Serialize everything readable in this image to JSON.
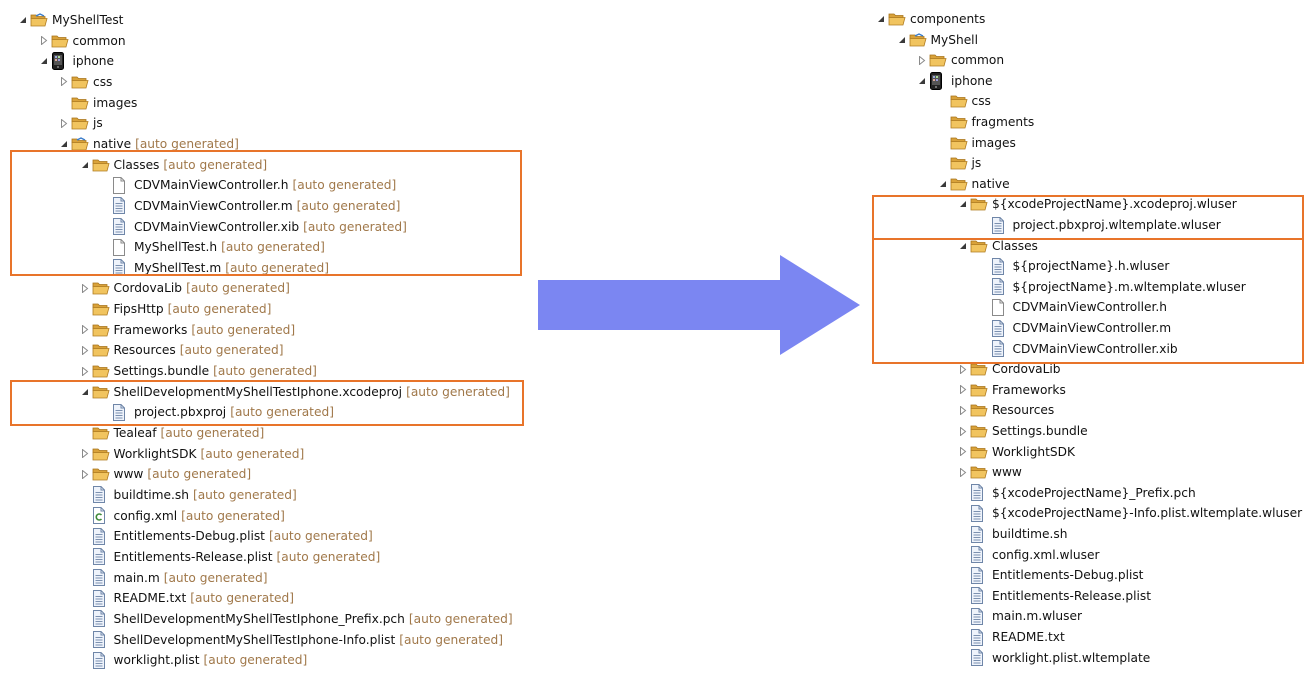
{
  "suffix": "[auto generated]",
  "colors": {
    "suffix": "#a0784a",
    "highlight": "#e8742a",
    "arrow": "#7b86f2",
    "folder": "#e8b34b"
  },
  "left_tree": [
    {
      "label": "MyShellTest",
      "icon": "project-folder-icon",
      "tw": "expanded",
      "depth": 0,
      "auto": false
    },
    {
      "label": "common",
      "icon": "folder-icon",
      "tw": "collapsed",
      "depth": 1,
      "auto": false
    },
    {
      "label": "iphone",
      "icon": "iphone-icon",
      "tw": "expanded",
      "depth": 1,
      "auto": false
    },
    {
      "label": "css",
      "icon": "folder-icon",
      "tw": "collapsed",
      "depth": 2,
      "auto": false
    },
    {
      "label": "images",
      "icon": "folder-icon",
      "tw": "none",
      "depth": 2,
      "auto": false
    },
    {
      "label": "js",
      "icon": "folder-icon",
      "tw": "collapsed",
      "depth": 2,
      "auto": false
    },
    {
      "label": "native",
      "icon": "project-folder-icon",
      "tw": "expanded",
      "depth": 2,
      "auto": true
    },
    {
      "label": "Classes",
      "icon": "folder-icon",
      "tw": "expanded",
      "depth": 3,
      "auto": true
    },
    {
      "label": "CDVMainViewController.h",
      "icon": "blank-file-icon",
      "tw": "none",
      "depth": 4,
      "auto": true
    },
    {
      "label": "CDVMainViewController.m",
      "icon": "text-file-icon",
      "tw": "none",
      "depth": 4,
      "auto": true
    },
    {
      "label": "CDVMainViewController.xib",
      "icon": "text-file-icon",
      "tw": "none",
      "depth": 4,
      "auto": true
    },
    {
      "label": "MyShellTest.h",
      "icon": "blank-file-icon",
      "tw": "none",
      "depth": 4,
      "auto": true
    },
    {
      "label": "MyShellTest.m",
      "icon": "text-file-icon",
      "tw": "none",
      "depth": 4,
      "auto": true
    },
    {
      "label": "CordovaLib",
      "icon": "folder-icon",
      "tw": "collapsed",
      "depth": 3,
      "auto": true
    },
    {
      "label": "FipsHttp",
      "icon": "folder-icon",
      "tw": "none",
      "depth": 3,
      "auto": true
    },
    {
      "label": "Frameworks",
      "icon": "folder-icon",
      "tw": "collapsed",
      "depth": 3,
      "auto": true
    },
    {
      "label": "Resources",
      "icon": "folder-icon",
      "tw": "collapsed",
      "depth": 3,
      "auto": true
    },
    {
      "label": "Settings.bundle",
      "icon": "folder-icon",
      "tw": "collapsed",
      "depth": 3,
      "auto": true
    },
    {
      "label": "ShellDevelopmentMyShellTestIphone.xcodeproj",
      "icon": "folder-icon",
      "tw": "expanded",
      "depth": 3,
      "auto": true
    },
    {
      "label": "project.pbxproj",
      "icon": "text-file-icon",
      "tw": "none",
      "depth": 4,
      "auto": true
    },
    {
      "label": "Tealeaf",
      "icon": "folder-icon",
      "tw": "none",
      "depth": 3,
      "auto": true
    },
    {
      "label": "WorklightSDK",
      "icon": "folder-icon",
      "tw": "collapsed",
      "depth": 3,
      "auto": true
    },
    {
      "label": "www",
      "icon": "folder-icon",
      "tw": "collapsed",
      "depth": 3,
      "auto": true
    },
    {
      "label": "buildtime.sh",
      "icon": "text-file-icon",
      "tw": "none",
      "depth": 3,
      "auto": true
    },
    {
      "label": "config.xml",
      "icon": "xml-file-icon",
      "tw": "none",
      "depth": 3,
      "auto": true
    },
    {
      "label": "Entitlements-Debug.plist",
      "icon": "text-file-icon",
      "tw": "none",
      "depth": 3,
      "auto": true
    },
    {
      "label": "Entitlements-Release.plist",
      "icon": "text-file-icon",
      "tw": "none",
      "depth": 3,
      "auto": true
    },
    {
      "label": "main.m",
      "icon": "text-file-icon",
      "tw": "none",
      "depth": 3,
      "auto": true
    },
    {
      "label": "README.txt",
      "icon": "text-file-icon",
      "tw": "none",
      "depth": 3,
      "auto": true
    },
    {
      "label": "ShellDevelopmentMyShellTestIphone_Prefix.pch",
      "icon": "text-file-icon",
      "tw": "none",
      "depth": 3,
      "auto": true
    },
    {
      "label": "ShellDevelopmentMyShellTestIphone-Info.plist",
      "icon": "text-file-icon",
      "tw": "none",
      "depth": 3,
      "auto": true
    },
    {
      "label": "worklight.plist",
      "icon": "text-file-icon",
      "tw": "none",
      "depth": 3,
      "auto": true
    }
  ],
  "right_tree": [
    {
      "label": "components",
      "icon": "folder-icon",
      "tw": "expanded",
      "depth": 0
    },
    {
      "label": "MyShell",
      "icon": "project-folder-icon",
      "tw": "expanded",
      "depth": 1
    },
    {
      "label": "common",
      "icon": "folder-icon",
      "tw": "collapsed",
      "depth": 2
    },
    {
      "label": "iphone",
      "icon": "iphone-icon",
      "tw": "expanded",
      "depth": 2
    },
    {
      "label": "css",
      "icon": "folder-icon",
      "tw": "none",
      "depth": 3
    },
    {
      "label": "fragments",
      "icon": "folder-icon",
      "tw": "none",
      "depth": 3
    },
    {
      "label": "images",
      "icon": "folder-icon",
      "tw": "none",
      "depth": 3
    },
    {
      "label": "js",
      "icon": "folder-icon",
      "tw": "none",
      "depth": 3
    },
    {
      "label": "native",
      "icon": "folder-icon",
      "tw": "expanded",
      "depth": 3
    },
    {
      "label": "${xcodeProjectName}.xcodeproj.wluser",
      "icon": "folder-icon",
      "tw": "expanded",
      "depth": 4
    },
    {
      "label": "project.pbxproj.wltemplate.wluser",
      "icon": "text-file-icon",
      "tw": "none",
      "depth": 5
    },
    {
      "label": "Classes",
      "icon": "folder-icon",
      "tw": "expanded",
      "depth": 4
    },
    {
      "label": "${projectName}.h.wluser",
      "icon": "text-file-icon",
      "tw": "none",
      "depth": 5
    },
    {
      "label": "${projectName}.m.wltemplate.wluser",
      "icon": "text-file-icon",
      "tw": "none",
      "depth": 5
    },
    {
      "label": "CDVMainViewController.h",
      "icon": "blank-file-icon",
      "tw": "none",
      "depth": 5
    },
    {
      "label": "CDVMainViewController.m",
      "icon": "text-file-icon",
      "tw": "none",
      "depth": 5
    },
    {
      "label": "CDVMainViewController.xib",
      "icon": "text-file-icon",
      "tw": "none",
      "depth": 5
    },
    {
      "label": "CordovaLib",
      "icon": "folder-icon",
      "tw": "collapsed",
      "depth": 4
    },
    {
      "label": "Frameworks",
      "icon": "folder-icon",
      "tw": "collapsed",
      "depth": 4
    },
    {
      "label": "Resources",
      "icon": "folder-icon",
      "tw": "collapsed",
      "depth": 4
    },
    {
      "label": "Settings.bundle",
      "icon": "folder-icon",
      "tw": "collapsed",
      "depth": 4
    },
    {
      "label": "WorklightSDK",
      "icon": "folder-icon",
      "tw": "collapsed",
      "depth": 4
    },
    {
      "label": "www",
      "icon": "folder-icon",
      "tw": "collapsed",
      "depth": 4
    },
    {
      "label": "${xcodeProjectName}_Prefix.pch",
      "icon": "text-file-icon",
      "tw": "none",
      "depth": 4
    },
    {
      "label": "${xcodeProjectName}-Info.plist.wltemplate.wluser",
      "icon": "text-file-icon",
      "tw": "none",
      "depth": 4
    },
    {
      "label": "buildtime.sh",
      "icon": "text-file-icon",
      "tw": "none",
      "depth": 4
    },
    {
      "label": "config.xml.wluser",
      "icon": "text-file-icon",
      "tw": "none",
      "depth": 4
    },
    {
      "label": "Entitlements-Debug.plist",
      "icon": "text-file-icon",
      "tw": "none",
      "depth": 4
    },
    {
      "label": "Entitlements-Release.plist",
      "icon": "text-file-icon",
      "tw": "none",
      "depth": 4
    },
    {
      "label": "main.m.wluser",
      "icon": "text-file-icon",
      "tw": "none",
      "depth": 4
    },
    {
      "label": "README.txt",
      "icon": "text-file-icon",
      "tw": "none",
      "depth": 4
    },
    {
      "label": "worklight.plist.wltemplate",
      "icon": "text-file-icon",
      "tw": "none",
      "depth": 4
    }
  ]
}
